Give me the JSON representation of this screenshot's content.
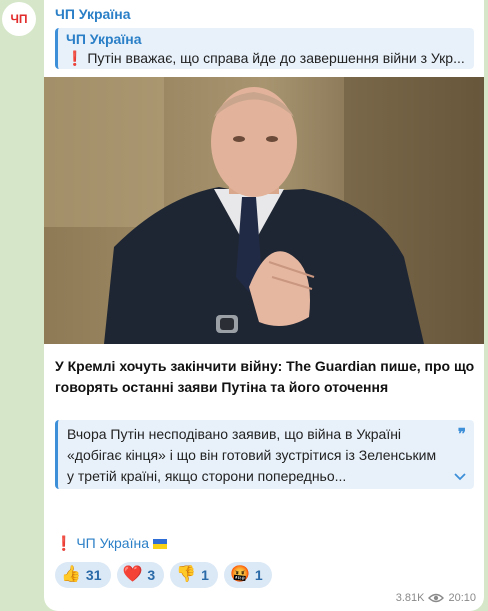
{
  "channel": {
    "avatar_text": "ЧП",
    "name": "ЧП Україна"
  },
  "reply": {
    "name": "ЧП Україна",
    "excl": "❗",
    "text": "Путін вважає, що справа йде до завершення війни з Укр..."
  },
  "photo": {
    "icon": "photo-of-man-in-suit"
  },
  "post": {
    "headline": "У Кремлі хочуть закінчити війну: The Guardian пише, про що говорять останні заяви Путіна та його оточення",
    "quote": "Вчора Путін несподівано заявив, що війна в Україні «добігає кінця» і що він готовий зустрітися із Зеленським у третій країні, якщо сторони попередньо...",
    "quote_mark": "❞",
    "expand_icon": "chevron-down-icon",
    "signature_excl": "❗",
    "signature": "ЧП Україна",
    "signature_flag": "ukraine-flag"
  },
  "reactions": [
    {
      "emoji": "👍",
      "count": "31"
    },
    {
      "emoji": "❤️",
      "count": "3"
    },
    {
      "emoji": "👎",
      "count": "1"
    },
    {
      "emoji": "🤬",
      "count": "1"
    }
  ],
  "meta": {
    "views": "3.81K",
    "time": "20:10"
  },
  "colors": {
    "accent": "#2a7fc7",
    "background": "#d6e7c9",
    "alert": "#d0221c"
  }
}
